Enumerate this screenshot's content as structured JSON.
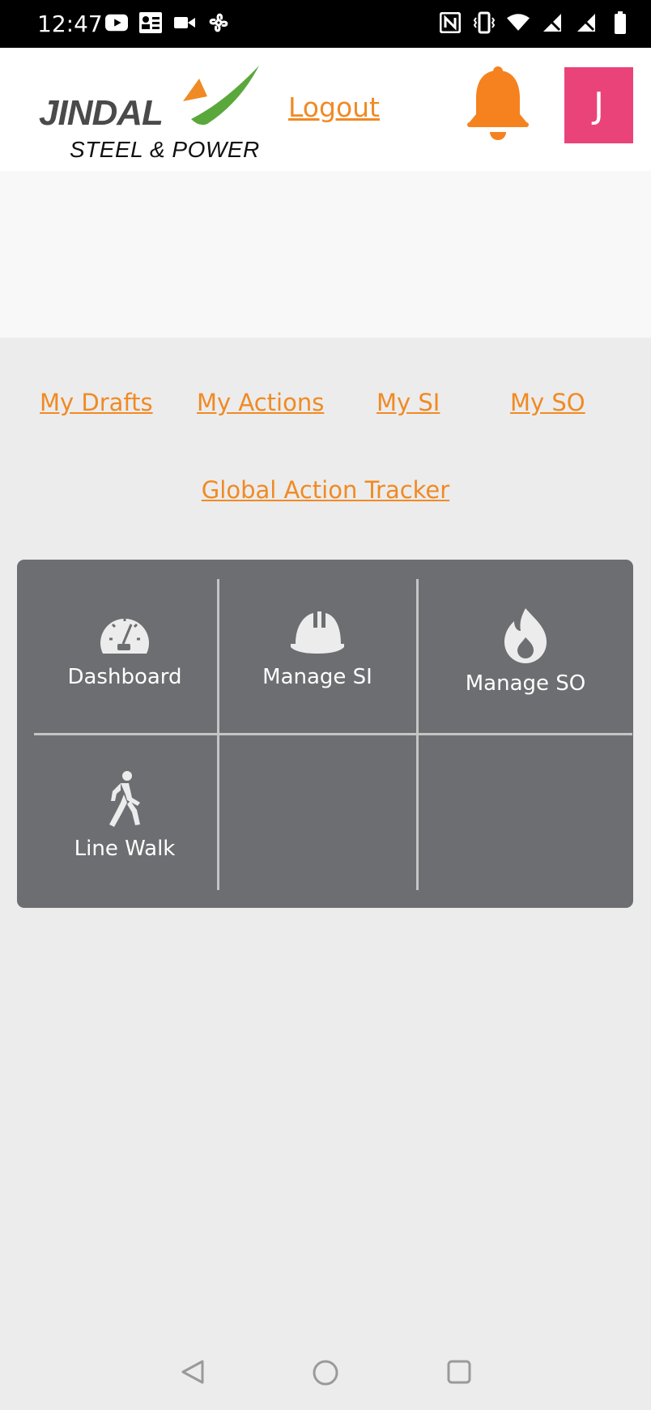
{
  "status_bar": {
    "time": "12:47",
    "left_icons": [
      "youtube-icon",
      "contacts-icon",
      "video-icon",
      "fan-icon"
    ],
    "right_icons": [
      "nfc-icon",
      "vibrate-icon",
      "wifi-icon",
      "no-signal-icon",
      "no-signal-icon",
      "battery-icon"
    ]
  },
  "header": {
    "logo_line1": "JINDAL",
    "logo_line2": "STEEL & POWER",
    "logout_label": "Logout",
    "notification_icon": "bell-icon",
    "avatar_initial": "J",
    "colors": {
      "accent": "#f08a24",
      "avatar_bg": "#e9437a",
      "bell": "#f5821f"
    }
  },
  "quick_links": [
    {
      "label": "My Drafts"
    },
    {
      "label": "My Actions"
    },
    {
      "label": "My SI"
    },
    {
      "label": "My SO"
    }
  ],
  "global_tracker_label": "Global Action Tracker",
  "menu_grid": {
    "tiles": [
      {
        "label": "Dashboard",
        "icon": "speedometer-icon"
      },
      {
        "label": "Manage SI",
        "icon": "hard-hat-icon"
      },
      {
        "label": "Manage SO",
        "icon": "fire-icon"
      },
      {
        "label": "Line Walk",
        "icon": "walking-person-icon"
      }
    ]
  },
  "nav_bar": {
    "buttons": [
      "back-icon",
      "home-icon",
      "recents-icon"
    ]
  }
}
